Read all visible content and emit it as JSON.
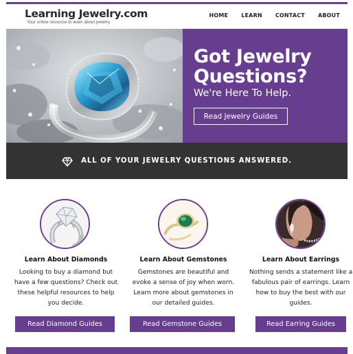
{
  "header": {
    "logo_title": "Learning Jewelry.com",
    "logo_tagline": "Your online resource to learn about jewelry.",
    "nav": [
      "HOME",
      "LEARN",
      "CONTACT",
      "ABOUT"
    ]
  },
  "hero": {
    "title": "Got Jewelry Questions?",
    "subtitle": "We're Here To Help.",
    "button_label": "Read Jewelry Guides"
  },
  "banner": {
    "icon": "diamond-outline-icon",
    "text": "ALL OF YOUR JEWELRY QUESTIONS ANSWERED."
  },
  "cards": [
    {
      "image": "diamond-ring-photo",
      "title": "Learn About Diamonds",
      "description": "Looking to buy a diamond but have a few questions? Check out these helpful resources to help you decide.",
      "button_label": "Read Diamond Guides"
    },
    {
      "image": "gemstone-ring-photo",
      "title": "Learn About Gemstones",
      "description": "Gemstones are beautiful and evoke a sense of joy when worn. Learn more about gemstones in our detailed guides.",
      "button_label": "Read Gemstone Guides"
    },
    {
      "image": "earrings-model-photo",
      "title": "Learn About Earrings",
      "description": "Nothing sends a statement like a fabulous pair of earrings. Learn how to buy the best with our guides.",
      "button_label": "Read Earring Guides"
    }
  ],
  "colors": {
    "brand_purple": "#673d8f",
    "banner_dark": "#333333",
    "text_dark": "#222222"
  }
}
